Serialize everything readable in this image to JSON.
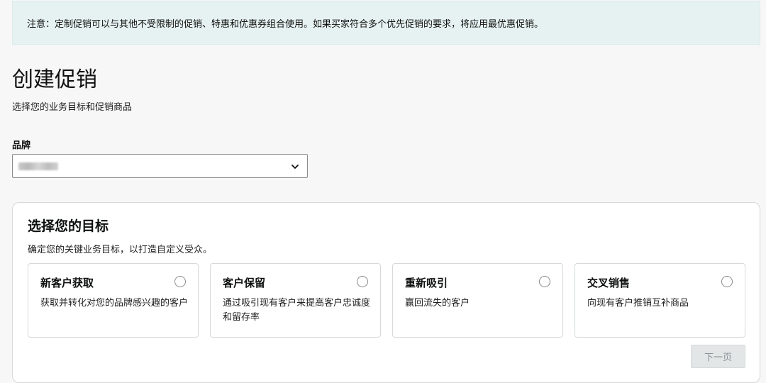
{
  "notice": {
    "text": "注意：定制促销可以与其他不受限制的促销、特惠和优惠券组合使用。如果买家符合多个优先促销的要求，将应用最优惠促销。"
  },
  "header": {
    "title": "创建促销",
    "subtitle": "选择您的业务目标和促销商品"
  },
  "brand": {
    "label": "品牌",
    "dropdown_icon": "chevron-down-icon"
  },
  "goal": {
    "title": "选择您的目标",
    "subtitle": "确定您的关键业务目标，以打造自定义受众。",
    "options": [
      {
        "title": "新客户获取",
        "desc": "获取并转化对您的品牌感兴趣的客户"
      },
      {
        "title": "客户保留",
        "desc": "通过吸引现有客户来提高客户忠诚度和留存率"
      },
      {
        "title": "重新吸引",
        "desc": "赢回流失的客户"
      },
      {
        "title": "交叉销售",
        "desc": "向现有客户推销互补商品"
      }
    ],
    "next_label": "下一页"
  }
}
